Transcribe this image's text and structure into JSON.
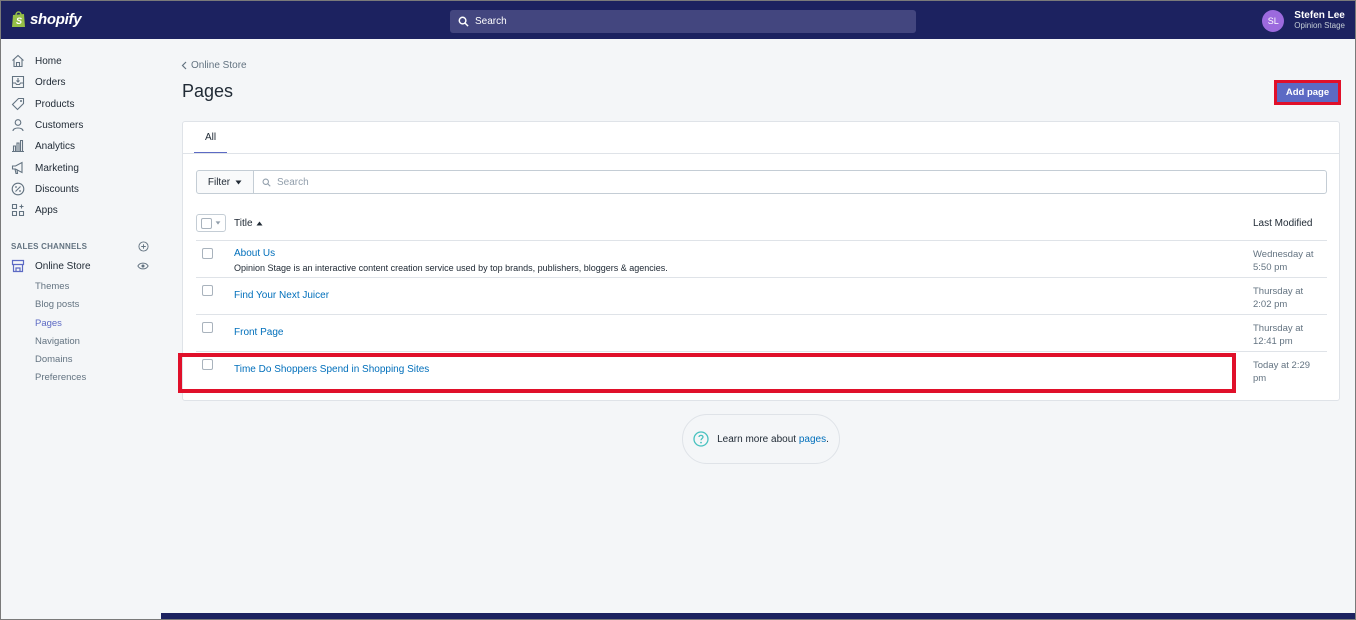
{
  "topbar": {
    "brand": "shopify",
    "search_placeholder": "Search",
    "user_initials": "SL",
    "user_name": "Stefen Lee",
    "user_shop": "Opinion Stage"
  },
  "sidebar": {
    "items": [
      {
        "label": "Home",
        "icon": "home-icon"
      },
      {
        "label": "Orders",
        "icon": "orders-icon"
      },
      {
        "label": "Products",
        "icon": "tag-icon"
      },
      {
        "label": "Customers",
        "icon": "person-icon"
      },
      {
        "label": "Analytics",
        "icon": "bar-chart-icon"
      },
      {
        "label": "Marketing",
        "icon": "megaphone-icon"
      },
      {
        "label": "Discounts",
        "icon": "discount-icon"
      },
      {
        "label": "Apps",
        "icon": "apps-icon"
      }
    ],
    "sales_channels_header": "SALES CHANNELS",
    "online_store": "Online Store",
    "sub_items": [
      "Themes",
      "Blog posts",
      "Pages",
      "Navigation",
      "Domains",
      "Preferences"
    ]
  },
  "main": {
    "breadcrumb": "Online Store",
    "title": "Pages",
    "add_button": "Add page",
    "tab": "All",
    "filter_label": "Filter",
    "search_placeholder": "Search",
    "col_title": "Title",
    "col_modified": "Last Modified",
    "rows": [
      {
        "title": "About Us",
        "desc": "Opinion Stage is an interactive content creation service used by top brands, publishers, bloggers & agencies.",
        "mod1": "Wednesday at",
        "mod2": "5:50 pm"
      },
      {
        "title": "Find Your Next Juicer",
        "desc": "",
        "mod1": "Thursday at",
        "mod2": "2:02 pm"
      },
      {
        "title": "Front Page",
        "desc": "",
        "mod1": "Thursday at",
        "mod2": "12:41 pm"
      },
      {
        "title": "Time Do Shoppers Spend in Shopping Sites",
        "desc": "",
        "mod1": "Today at 2:29",
        "mod2": "pm"
      }
    ],
    "learn_text": "Learn more about",
    "learn_link": "pages",
    "learn_period": "."
  },
  "colors": {
    "topbar": "#1c2260",
    "accent": "#5c6ac4",
    "link": "#006fbb",
    "highlight": "#e0102a"
  }
}
